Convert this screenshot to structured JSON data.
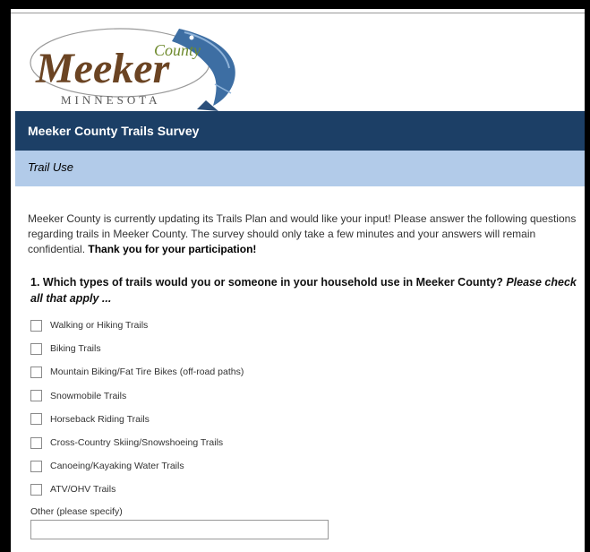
{
  "logo": {
    "word": "Meeker",
    "county": "County",
    "state": "MINNESOTA"
  },
  "survey": {
    "title": "Meeker County Trails Survey",
    "section": "Trail Use",
    "intro": "Meeker County is currently updating its Trails Plan and would like your input!  Please answer the following questions regarding trails in Meeker County.  The survey should only take a few minutes and your answers will remain confidential.",
    "intro_bold": "Thank you for your participation!",
    "question": "1. Which types of trails would you or someone in your household use in Meeker County?",
    "question_hint": "Please check all that apply ...",
    "options": [
      "Walking or Hiking Trails",
      "Biking Trails",
      "Mountain Biking/Fat Tire Bikes (off-road paths)",
      "Snowmobile Trails",
      "Horseback Riding Trails",
      "Cross-Country Skiing/Snowshoeing Trails",
      "Canoeing/Kayaking Water Trails",
      "ATV/OHV Trails"
    ],
    "other_label": "Other (please specify)",
    "other_value": ""
  },
  "colors": {
    "title_bar": "#1c3f66",
    "section_bar": "#b2cbe9",
    "logo_brown": "#6b4423",
    "logo_green": "#6e8a2d",
    "fish_blue": "#3d6ea3"
  }
}
